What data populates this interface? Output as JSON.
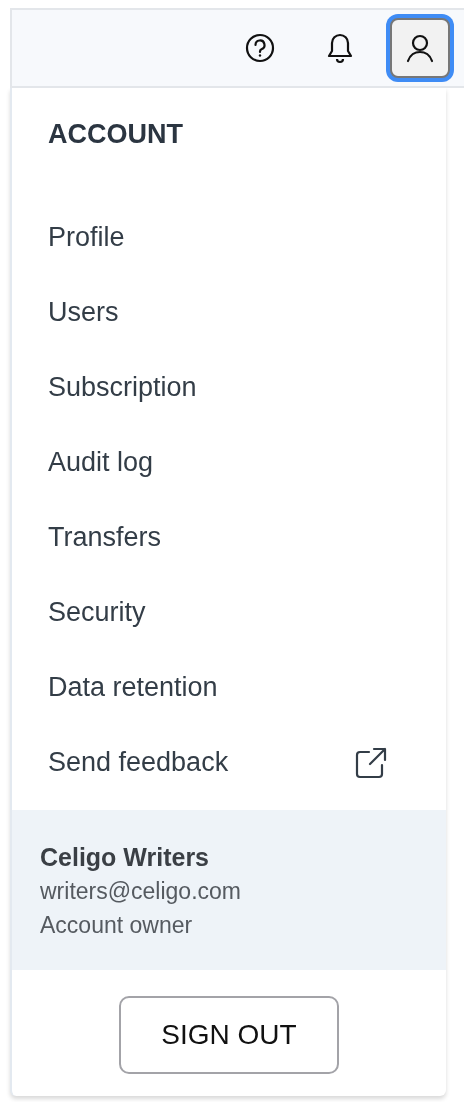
{
  "toolbar": {
    "buttons": [
      {
        "kind": "help",
        "selected": false
      },
      {
        "kind": "notifications",
        "selected": false
      },
      {
        "kind": "profile",
        "selected": true
      }
    ]
  },
  "menu": {
    "heading": "ACCOUNT",
    "items": [
      {
        "label": "Profile",
        "kind": "link"
      },
      {
        "label": "Users",
        "kind": "link"
      },
      {
        "label": "Subscription",
        "kind": "link"
      },
      {
        "label": "Audit log",
        "kind": "link"
      },
      {
        "label": "Transfers",
        "kind": "link"
      },
      {
        "label": "Security",
        "kind": "link"
      },
      {
        "label": "Data retention",
        "kind": "link"
      },
      {
        "label": "Send feedback",
        "kind": "external"
      }
    ]
  },
  "account": {
    "name": "Celigo Writers",
    "email": "writers@celigo.com",
    "role": "Account owner"
  },
  "sign_out": "SIGN OUT"
}
